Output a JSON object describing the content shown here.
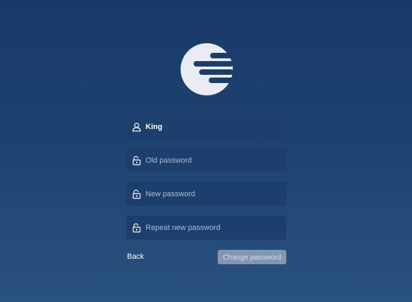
{
  "logo": {
    "icon": "app-logo-icon",
    "color": "#e9edf3"
  },
  "form": {
    "username": {
      "icon": "user-icon",
      "value": "King"
    },
    "old_password": {
      "icon": "lock-icon",
      "placeholder": "Old password"
    },
    "new_password": {
      "icon": "lock-icon",
      "placeholder": "New password"
    },
    "repeat_password": {
      "icon": "lock-icon",
      "placeholder": "Repeat new password"
    }
  },
  "actions": {
    "back_label": "Back",
    "change_label": "Change password"
  },
  "colors": {
    "background_top": "#183a68",
    "background_bottom": "#2a527e",
    "field_bg": "#1d3f6d",
    "button_disabled_bg": "#8197b4"
  }
}
